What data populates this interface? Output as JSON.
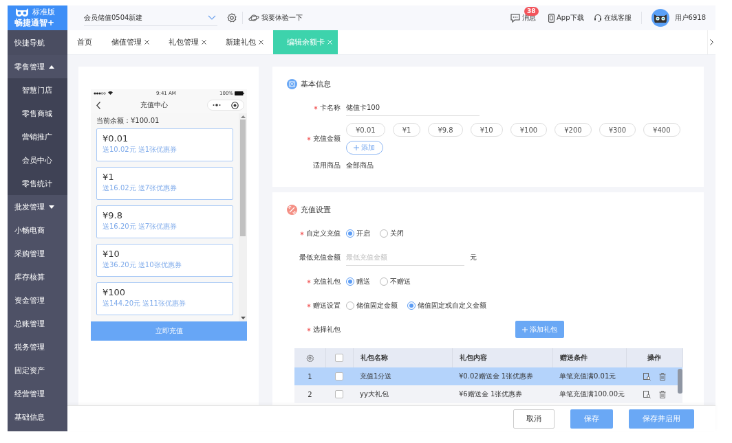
{
  "logo": {
    "edition": "标准版",
    "product": "畅捷通智+"
  },
  "sidebar": {
    "quick_nav": "快捷导航",
    "items": [
      {
        "label": "零售管理",
        "expanded": true,
        "children": [
          {
            "label": "智慧门店"
          },
          {
            "label": "零售商城"
          },
          {
            "label": "营销推广"
          },
          {
            "label": "会员中心"
          },
          {
            "label": "零售统计"
          }
        ]
      },
      {
        "label": "批发管理",
        "expanded": false
      },
      {
        "label": "小畅电商"
      },
      {
        "label": "采购管理"
      },
      {
        "label": "库存核算"
      },
      {
        "label": "资金管理"
      },
      {
        "label": "总账管理"
      },
      {
        "label": "税务管理"
      },
      {
        "label": "固定资产"
      },
      {
        "label": "经营管理"
      },
      {
        "label": "基础信息"
      }
    ]
  },
  "header": {
    "store_select": {
      "value": "会员储值0504新建"
    },
    "try_link": "我要体验一下",
    "messages": {
      "label": "消息",
      "badge": "38"
    },
    "app_download": "App下载",
    "support": "在线客服",
    "user": "用户6918"
  },
  "tabs": [
    {
      "label": "首页",
      "closable": false,
      "selected": false
    },
    {
      "label": "储值管理",
      "closable": true,
      "selected": false
    },
    {
      "label": "礼包管理",
      "closable": true,
      "selected": false
    },
    {
      "label": "新建礼包",
      "closable": true,
      "selected": false
    },
    {
      "label": "编辑余额卡",
      "closable": true,
      "selected": true
    }
  ],
  "preview": {
    "time": "9:41 AM",
    "battery": "100%",
    "title": "充值中心",
    "balance": "当前余额：¥100.01",
    "options": [
      {
        "amount": "¥0.01",
        "bonus": "送10.02元 送1张优惠券"
      },
      {
        "amount": "¥1",
        "bonus": "送16.02元 送7张优惠券"
      },
      {
        "amount": "¥9.8",
        "bonus": "送16.20元 送7张优惠券"
      },
      {
        "amount": "¥10",
        "bonus": "送36.20元 送10张优惠券"
      },
      {
        "amount": "¥100",
        "bonus": "送144.20元 送11张优惠券"
      }
    ],
    "button": "立即充值"
  },
  "basic_info": {
    "title": "基本信息",
    "card_name": {
      "label": "卡名称",
      "required": true,
      "value": "储值卡100"
    },
    "amounts": {
      "label": "充值金额",
      "required": true,
      "chips": [
        "¥0.01",
        "¥1",
        "¥9.8",
        "¥10",
        "¥100",
        "¥200",
        "¥300",
        "¥400"
      ],
      "add_button": "添加"
    },
    "applicable": {
      "label": "适用商品",
      "required": false,
      "value": "全部商品"
    }
  },
  "recharge_settings": {
    "title": "充值设置",
    "rows": [
      {
        "kind": "radio",
        "label": "自定义充值",
        "required": true,
        "options": [
          {
            "label": "开启",
            "selected": true
          },
          {
            "label": "关闭",
            "selected": false
          }
        ]
      },
      {
        "kind": "input",
        "label": "最低充值金额",
        "required": false,
        "placeholder": "最低充值金额",
        "unit": "元"
      },
      {
        "kind": "radio",
        "label": "充值礼包",
        "required": true,
        "options": [
          {
            "label": "赠送",
            "selected": true
          },
          {
            "label": "不赠送",
            "selected": false
          }
        ]
      },
      {
        "kind": "radio",
        "label": "赠送设置",
        "required": true,
        "options": [
          {
            "label": "储值固定金额",
            "selected": false
          },
          {
            "label": "储值固定或自定义金额",
            "selected": true
          }
        ]
      },
      {
        "kind": "button",
        "label": "选择礼包",
        "required": true,
        "button": "添加礼包"
      }
    ],
    "table": {
      "all_checked": false,
      "columns": [
        "礼包名称",
        "礼包内容",
        "赠送条件",
        "操作"
      ],
      "rows": [
        {
          "index": "1",
          "checked": false,
          "selected": true,
          "name": "充值1分送",
          "content": "¥0.02赠送金 1张优惠券",
          "condition": "单笔充值满0.01元"
        },
        {
          "index": "2",
          "checked": false,
          "selected": false,
          "name": "yy大礼包",
          "content": "¥6赠送金 1张优惠券",
          "condition": "单笔充值满100.00元"
        }
      ]
    }
  },
  "footer": {
    "buttons": [
      {
        "label": "取消",
        "kind": "default"
      },
      {
        "label": "保存",
        "kind": "primary"
      },
      {
        "label": "保存并启用",
        "kind": "primary"
      }
    ]
  }
}
